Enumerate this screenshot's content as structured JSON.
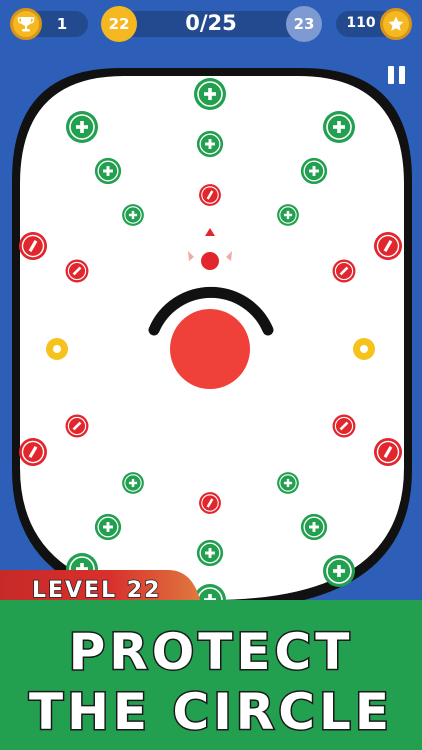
{
  "hud": {
    "trophy_count": "1",
    "current_level": "22",
    "progress": "0/25",
    "next_level": "23",
    "coins": "110",
    "icons": [
      "trophy-icon",
      "star-icon",
      "pause-icon"
    ]
  },
  "arena": {
    "center_ball_color": "#f0403a",
    "plus_color": "#22a050",
    "minus_color": "#e2262e",
    "ring_color": "#f6c21c"
  },
  "banner": {
    "level_label": "LEVEL 22",
    "headline_line1": "PROTECT",
    "headline_line2": "THE CIRCLE"
  },
  "colors": {
    "background": "#2d5fb8",
    "coin_gold": "#f6b820",
    "banner_green": "#22a050",
    "level_tab_red": "#d9302c"
  }
}
